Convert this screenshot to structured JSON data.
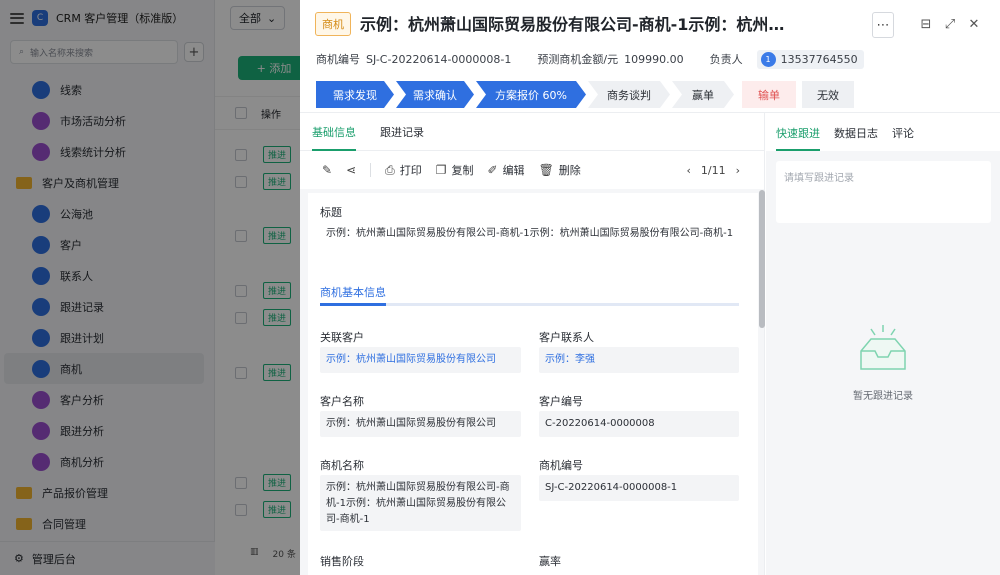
{
  "app": {
    "title": "CRM 客户管理（标准版）",
    "search_placeholder": "输入名称来搜索",
    "sidebar_items": [
      {
        "label": "线索",
        "icon": "lead-icon"
      },
      {
        "label": "市场活动分析",
        "icon": "chart-icon"
      },
      {
        "label": "线索统计分析",
        "icon": "chart-icon"
      },
      {
        "label": "客户及商机管理",
        "icon": "folder-icon",
        "group": true
      },
      {
        "label": "公海池",
        "icon": "pool-icon"
      },
      {
        "label": "客户",
        "icon": "customer-icon"
      },
      {
        "label": "联系人",
        "icon": "contact-icon"
      },
      {
        "label": "跟进记录",
        "icon": "record-icon"
      },
      {
        "label": "跟进计划",
        "icon": "plan-icon"
      },
      {
        "label": "商机",
        "icon": "opportunity-icon",
        "active": true
      },
      {
        "label": "客户分析",
        "icon": "chart-icon"
      },
      {
        "label": "跟进分析",
        "icon": "chart-icon"
      },
      {
        "label": "商机分析",
        "icon": "chart-icon"
      },
      {
        "label": "产品报价管理",
        "icon": "folder-icon",
        "group": true
      },
      {
        "label": "合同管理",
        "icon": "folder-icon",
        "group": true
      }
    ],
    "footer": "管理后台",
    "filter_value": "全部",
    "add_label": "+ 添加",
    "op_header": "操作",
    "row_action": "推进",
    "page_size": "20 条"
  },
  "drawer": {
    "type_badge": "商机",
    "title": "示例：杭州萧山国际贸易股份有限公司-商机-1示例：杭州萧…",
    "meta": {
      "code_label": "商机编号",
      "code_value": "SJ-C-20220614-0000008-1",
      "amount_label": "预测商机金额/元",
      "amount_value": "109990.00",
      "owner_label": "负责人",
      "owner_avatar": "1",
      "owner_value": "13537764550"
    },
    "stages": [
      "需求发现",
      "需求确认",
      "方案报价 60%",
      "商务谈判",
      "赢单",
      "输单",
      "无效"
    ],
    "tabs": [
      "基础信息",
      "跟进记录"
    ],
    "toolbar": {
      "print": "打印",
      "copy": "复制",
      "edit": "编辑",
      "delete": "删除",
      "pager": "1/11"
    },
    "fields": {
      "title_label": "标题",
      "title_value": "示例：杭州萧山国际贸易股份有限公司-商机-1示例：杭州萧山国际贸易股份有限公司-商机-1",
      "section": "商机基本信息",
      "rel_customer_label": "关联客户",
      "rel_customer_value": "示例：杭州萧山国际贸易股份有限公司",
      "contact_label": "客户联系人",
      "contact_value": "示例：李强",
      "customer_name_label": "客户名称",
      "customer_name_value": "示例：杭州萧山国际贸易股份有限公司",
      "customer_code_label": "客户编号",
      "customer_code_value": "C-20220614-0000008",
      "opp_name_label": "商机名称",
      "opp_name_value": "示例：杭州萧山国际贸易股份有限公司-商机-1示例：杭州萧山国际贸易股份有限公司-商机-1",
      "opp_code_label": "商机编号",
      "opp_code_value": "SJ-C-20220614-0000008-1",
      "stage_label": "销售阶段",
      "win_rate_label": "赢率"
    },
    "right_tabs": [
      "快速跟进",
      "数据日志",
      "评论"
    ],
    "quick_placeholder": "请填写跟进记录",
    "empty_text": "暂无跟进记录"
  }
}
